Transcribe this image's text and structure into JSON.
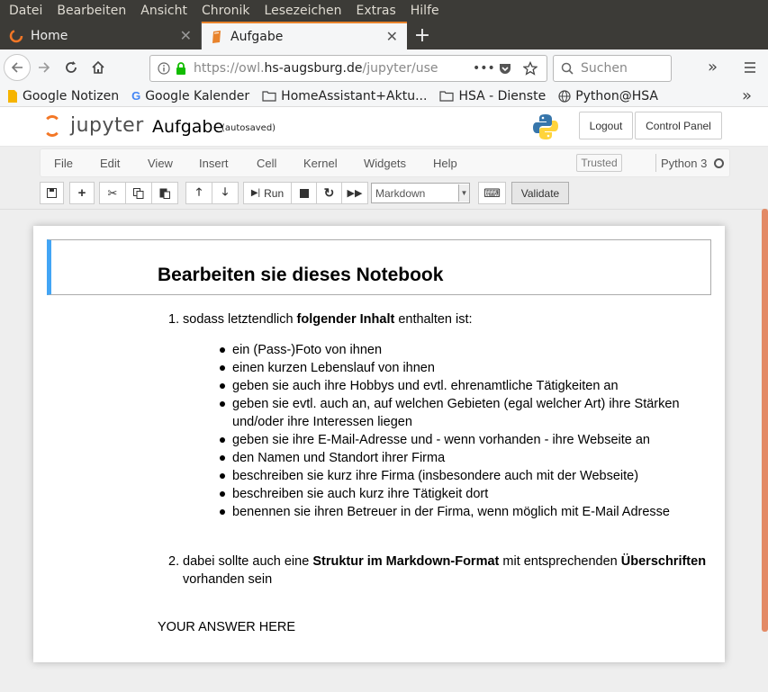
{
  "menubar": [
    "Datei",
    "Bearbeiten",
    "Ansicht",
    "Chronik",
    "Lesezeichen",
    "Extras",
    "Hilfe"
  ],
  "tabs": [
    {
      "label": "Home",
      "active": false
    },
    {
      "label": "Aufgabe",
      "active": true
    }
  ],
  "nav": {
    "url_prefix": "https://owl.",
    "url_domain": "hs-augsburg.de",
    "url_rest": "/jupyter/use",
    "search_placeholder": "Suchen"
  },
  "bookmarks": [
    "Google Notizen",
    "Google Kalender",
    "HomeAssistant+Aktu...",
    "HSA - Dienste",
    "Python@HSA"
  ],
  "jupyter": {
    "logo_text": "jupyter",
    "notebook_name": "Aufgabe",
    "autosave": "(autosaved)",
    "logout": "Logout",
    "control_panel": "Control Panel"
  },
  "menu": {
    "items": [
      "File",
      "Edit",
      "View",
      "Insert",
      "Cell",
      "Kernel",
      "Widgets",
      "Help"
    ],
    "trusted": "Trusted",
    "kernel": "Python 3"
  },
  "toolbar": {
    "run": "Run",
    "cell_type": "Markdown",
    "validate": "Validate"
  },
  "cell": {
    "heading": "Bearbeiten sie dieses Notebook",
    "item1": {
      "num": "1.",
      "pre": "sodass letztendlich ",
      "bold": "folgender Inhalt",
      "post": " enthalten ist:"
    },
    "bullets": [
      "ein (Pass-)Foto von ihnen",
      "einen kurzen Lebenslauf von ihnen",
      "geben sie auch ihre Hobbys und evtl. ehrenamtliche Tätigkeiten an",
      "geben sie evtl. auch an, auf welchen Gebieten (egal welcher Art) ihre Stärken und/oder ihre Interessen liegen",
      "geben sie ihre E-Mail-Adresse und - wenn vorhanden - ihre Webseite an",
      "den Namen und Standort ihrer Firma",
      "beschreiben sie kurz ihre Firma (insbesondere auch mit der Webseite)",
      "beschreiben sie auch kurz ihre Tätigkeit dort",
      "benennen sie ihren Betreuer in der Firma, wenn möglich mit E-Mail Adresse"
    ],
    "item2": {
      "num": "2.",
      "pre": "dabei sollte auch eine ",
      "bold1": "Struktur im Markdown-Format",
      "mid": " mit entsprechenden ",
      "bold2": "Überschriften",
      "post": " vorhanden sein"
    },
    "answer": "YOUR ANSWER HERE"
  }
}
